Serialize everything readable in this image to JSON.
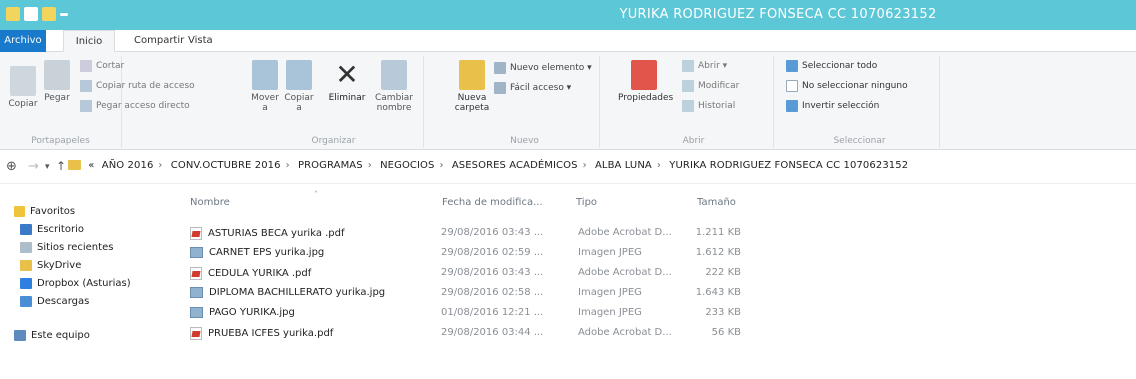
{
  "window": {
    "title": "YURIKA  RODRIGUEZ FONSECA  CC  1070623152"
  },
  "tabs": {
    "file": "Archivo",
    "home": "Inicio",
    "share": "Compartir",
    "view": "Vista"
  },
  "ribbon": {
    "clipboard": {
      "copy": "Copiar",
      "paste": "Pegar",
      "cut": "Cortar",
      "copy_path": "Copiar ruta de acceso",
      "paste_shortcut": "Pegar acceso directo",
      "label": "Portapapeles"
    },
    "organize": {
      "move": "Mover a",
      "copy_to": "Copiar a",
      "delete": "Eliminar",
      "rename": "Cambiar nombre",
      "label": "Organizar"
    },
    "new": {
      "new_folder": "Nueva carpeta",
      "new_item": "Nuevo elemento ▾",
      "easy_access": "Fácil acceso ▾",
      "label": "Nuevo"
    },
    "open": {
      "properties": "Propiedades",
      "open": "Abrir ▾",
      "edit": "Modificar",
      "history": "Historial",
      "label": "Abrir"
    },
    "select": {
      "select_all": "Seleccionar todo",
      "select_none": "No seleccionar ninguno",
      "invert": "Invertir selección",
      "label": "Seleccionar"
    }
  },
  "breadcrumb": [
    "«",
    "AÑO 2016",
    "CONV.OCTUBRE 2016",
    "PROGRAMAS",
    "NEGOCIOS",
    "ASESORES ACADÉMICOS",
    "ALBA LUNA",
    "YURIKA  RODRIGUEZ FONSECA  CC  1070623152"
  ],
  "sidebar": {
    "favorites": "Favoritos",
    "items": [
      "Escritorio",
      "Sitios recientes",
      "SkyDrive",
      "Dropbox (Asturias)",
      "Descargas"
    ],
    "this_pc": "Este equipo"
  },
  "columns": {
    "name": "Nombre",
    "date": "Fecha de modifica...",
    "type": "Tipo",
    "size": "Tamaño"
  },
  "files": [
    {
      "name": "ASTURIAS BECA yurika .pdf",
      "date": "29/08/2016 03:43 ...",
      "type": "Adobe Acrobat D...",
      "size": "1.211 KB",
      "icon": "pdf-icon"
    },
    {
      "name": "CARNET EPS yurika.jpg",
      "date": "29/08/2016 02:59 ...",
      "type": "Imagen JPEG",
      "size": "1.612 KB",
      "icon": "jpeg-icon"
    },
    {
      "name": "CEDULA YURIKA .pdf",
      "date": "29/08/2016 03:43 ...",
      "type": "Adobe Acrobat D...",
      "size": "222 KB",
      "icon": "pdf-icon"
    },
    {
      "name": "DIPLOMA BACHILLERATO yurika.jpg",
      "date": "29/08/2016 02:58 ...",
      "type": "Imagen JPEG",
      "size": "1.643 KB",
      "icon": "jpeg-icon"
    },
    {
      "name": "PAGO YURIKA.jpg",
      "date": "01/08/2016 12:21 ...",
      "type": "Imagen JPEG",
      "size": "233 KB",
      "icon": "jpeg-icon"
    },
    {
      "name": "PRUEBA ICFES yurika.pdf",
      "date": "29/08/2016 03:44 ...",
      "type": "Adobe Acrobat D...",
      "size": "56 KB",
      "icon": "pdf-icon"
    }
  ]
}
